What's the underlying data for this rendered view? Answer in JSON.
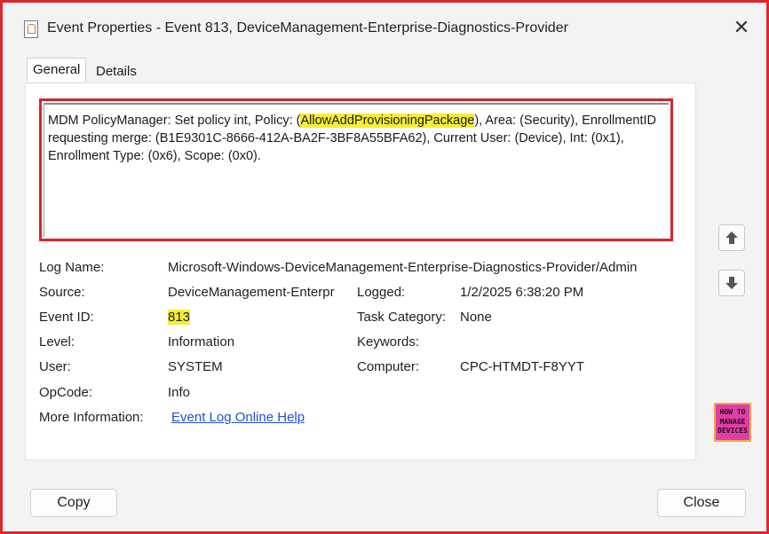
{
  "window": {
    "title": "Event Properties - Event 813, DeviceManagement-Enterprise-Diagnostics-Provider"
  },
  "tabs": [
    {
      "label": "General",
      "selected": true
    },
    {
      "label": "Details",
      "selected": false
    }
  ],
  "message": {
    "before": "MDM PolicyManager: Set policy int, Policy: (",
    "highlight": "AllowAddProvisioningPackage",
    "after": "), Area: (Security), EnrollmentID requesting merge: (B1E9301C-8666-412A-BA2F-3BF8A55BFA62), Current User: (Device), Int: (0x1), Enrollment Type: (0x6), Scope: (0x0)."
  },
  "fields": {
    "log_name": {
      "label": "Log Name:",
      "value": "Microsoft-Windows-DeviceManagement-Enterprise-Diagnostics-Provider/Admin"
    },
    "source": {
      "label": "Source:",
      "value": "DeviceManagement-Enterpr"
    },
    "logged": {
      "label": "Logged:",
      "value": "1/2/2025 6:38:20 PM"
    },
    "event_id": {
      "label": "Event ID:",
      "value": "813"
    },
    "task_category": {
      "label": "Task Category:",
      "value": "None"
    },
    "level": {
      "label": "Level:",
      "value": "Information"
    },
    "keywords": {
      "label": "Keywords:",
      "value": ""
    },
    "user": {
      "label": "User:",
      "value": "SYSTEM"
    },
    "computer": {
      "label": "Computer:",
      "value": "CPC-HTMDT-F8YYT"
    },
    "opcode": {
      "label": "OpCode:",
      "value": "Info"
    },
    "more_info": {
      "label": "More Information:",
      "value": "Event Log Online Help"
    }
  },
  "logo": {
    "line1": "HOW TO",
    "line2": "MANAGE",
    "line3": "DEVICES"
  },
  "buttons": {
    "copy": "Copy",
    "close": "Close"
  },
  "colors": {
    "highlight": "#f6ee32",
    "annotation_border": "#e0262d",
    "link": "#1f4fd8"
  }
}
